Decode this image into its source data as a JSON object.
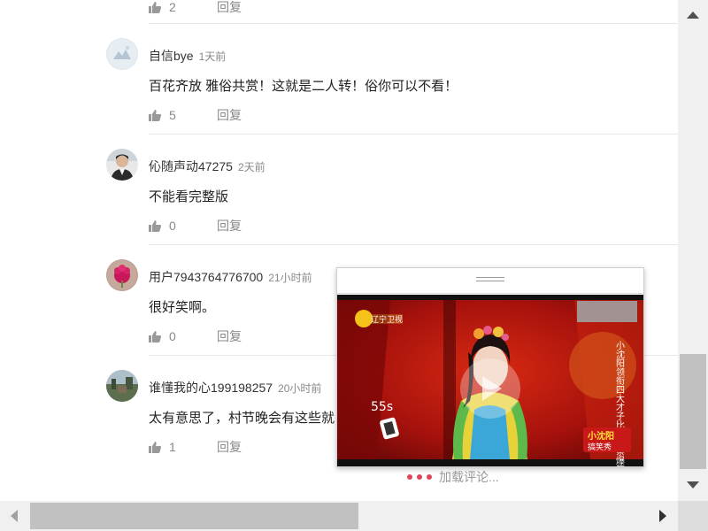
{
  "comments": [
    {
      "username": "",
      "time": "",
      "text": "",
      "likes": "2",
      "reply": "回复"
    },
    {
      "username": "自信bye",
      "time": "1天前",
      "text": "百花齐放 雅俗共赏！这就是二人转！俗你可以不看！",
      "likes": "5",
      "reply": "回复"
    },
    {
      "username": "伈随声动47275",
      "time": "2天前",
      "text": "不能看完整版",
      "likes": "0",
      "reply": "回复"
    },
    {
      "username": "用户7943764776700",
      "time": "21小时前",
      "text": "很好笑啊。",
      "likes": "0",
      "reply": "回复"
    },
    {
      "username": "谁懂我的心199198257",
      "time": "20小时前",
      "text": "太有意思了，村节晚会有这些就",
      "likes": "1",
      "reply": "回复"
    }
  ],
  "loading_text": "加载评论...",
  "video": {
    "channel_logo_text": "辽宁卫视",
    "timer_text": "55s",
    "side_caption": "小沈阳领衔四大才子比文招亲爆笑全场",
    "show_logo_text": "小沈阳",
    "show_logo_sub": "搞笑秀"
  },
  "colors": {
    "accent": "#e0445a",
    "scroll_thumb": "#c1c1c1",
    "text_secondary": "#888888"
  }
}
